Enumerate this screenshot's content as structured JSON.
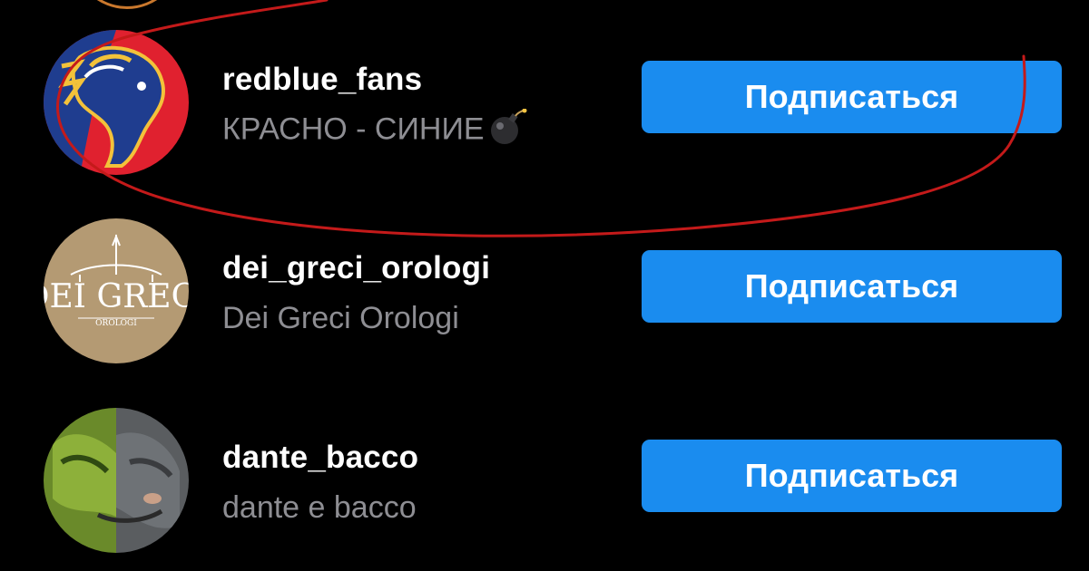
{
  "suggestions": [
    {
      "username": "redblue_fans",
      "subtitle": "КРАСНО - СИНИЕ",
      "subtitle_emoji": "bomb-icon",
      "button_label": "Подписаться",
      "avatar_colors": {
        "background": "#e0212f",
        "horse": "#1f3d8f"
      }
    },
    {
      "username": "dei_greci_orologi",
      "subtitle": "Dei Greci Orologi",
      "button_label": "Подписаться",
      "avatar_colors": {
        "background": "#b49a73",
        "ink": "#ffffff"
      },
      "avatar_logo_text": "DEI GRECI",
      "avatar_logo_subtext": "OROLOGI"
    },
    {
      "username": "dante_bacco",
      "subtitle": "dante e bacco",
      "button_label": "Подписаться",
      "avatar_colors": {
        "left": "#6a8a2a",
        "right": "#5a5d60"
      }
    }
  ],
  "colors": {
    "background": "#000000",
    "button": "#1a8cef",
    "username": "#ffffff",
    "subtitle": "#8e8e93",
    "annotation": "#c41a1a"
  }
}
